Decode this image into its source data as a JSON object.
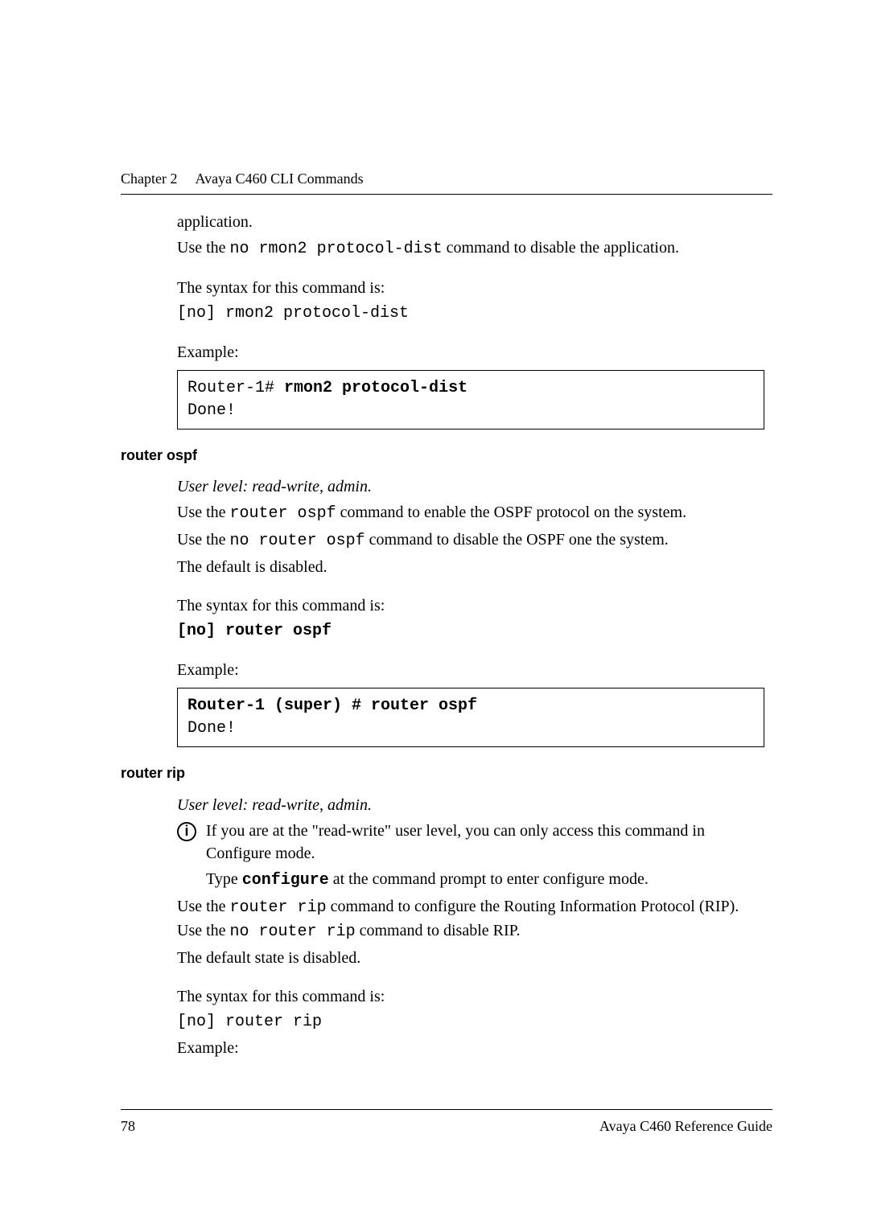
{
  "header": {
    "chapter": "Chapter 2",
    "title": "Avaya C460 CLI Commands"
  },
  "section1": {
    "cont_application": "application.",
    "use_no_prefix": "Use the ",
    "use_no_cmd": "no rmon2 protocol-dist",
    "use_no_suffix": " command to disable the application.",
    "syntax_intro": "The syntax for this command is:",
    "syntax_line": "[no] rmon2 protocol-dist",
    "example_label": "Example:",
    "ex_prompt": "Router-1# ",
    "ex_cmd": "rmon2 protocol-dist",
    "ex_out": "Done!"
  },
  "section2": {
    "heading": "router ospf",
    "user_level": "User level: read-write, admin.",
    "p1_pre": "Use the ",
    "p1_cmd": "router ospf",
    "p1_post": " command to enable the OSPF protocol on the system.",
    "p2_pre": "Use the ",
    "p2_cmd": "no router ospf",
    "p2_post": " command to disable the OSPF one the system.",
    "p3": "The default is disabled.",
    "syntax_intro": "The syntax for this command is:",
    "syntax_line": "[no] router ospf",
    "example_label": "Example:",
    "ex_cmd": "Router-1 (super) # router ospf",
    "ex_out": "Done!"
  },
  "section3": {
    "heading": "router rip",
    "user_level": "User level: read-write, admin.",
    "note_line1": "If you are at the \"read-write\" user level, you can only access this command in Configure mode.",
    "note_line2_pre": "Type ",
    "note_line2_cmd": "configure",
    "note_line2_post": " at the command prompt to enter configure mode.",
    "p1_pre": "Use the ",
    "p1_cmd": "router rip",
    "p1_post": " command to configure the Routing Information Protocol (RIP). Use the ",
    "p1_cmd2": "no router rip",
    "p1_post2": " command to disable RIP.",
    "p2": "The default state is disabled.",
    "syntax_intro": "The syntax for this command is:",
    "syntax_line": "[no] router rip",
    "example_label": "Example:"
  },
  "footer": {
    "page_num": "78",
    "guide": "Avaya C460 Reference Guide"
  }
}
